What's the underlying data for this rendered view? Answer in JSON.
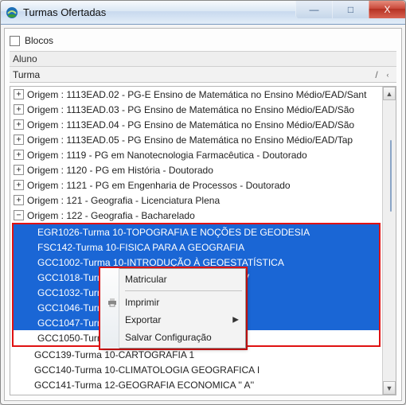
{
  "window": {
    "title": "Turmas Ofertadas",
    "minimize_glyph": "—",
    "maximize_glyph": "□",
    "close_glyph": "X"
  },
  "blocos": {
    "label": "Blocos"
  },
  "aluno_label": "Aluno",
  "turma_col": {
    "label": "Turma",
    "mark": "/"
  },
  "rows": {
    "r0": "Origem : 1113EAD.02 - PG-E Ensino de Matemática no Ensino Médio/EAD/Sant",
    "r1": "Origem : 1113EAD.03 - PG Ensino de Matemática no Ensino Médio/EAD/São",
    "r2": "Origem : 1113EAD.04 - PG Ensino de Matemática no Ensino Médio/EAD/São",
    "r3": "Origem : 1113EAD.05 - PG Ensino de Matemática no Ensino Médio/EAD/Tap",
    "r4": "Origem : 1119 - PG em Nanotecnologia Farmacêutica - Doutorado",
    "r5": "Origem : 1120 - PG em História - Doutorado",
    "r6": "Origem : 1121 - PG em Engenharia de Processos - Doutorado",
    "r7": "Origem : 121 - Geografia - Licenciatura Plena",
    "r8": "Origem : 122 - Geografia - Bacharelado",
    "c0": "EGR1026-Turma 10-TOPOGRAFIA E NOÇÕES DE GEODESIA",
    "c1": "FSC142-Turma 10-FISICA PARA A GEOGRAFIA",
    "c2": "GCC1002-Turma 10-INTRODUÇÃO À GEOESTATÍSTICA",
    "c3": "GCC1018-Turma-                                          MO, AÇÕES PARA O DESENV",
    "c4": "GCC1032-Turm                                            E PERÍCIA AMBIENTAL",
    "c5": "GCC1046-Turm                                            ICULTURA",
    "c6": "GCC1047-Turm                                            DO REAL AO VIRTUAL",
    "c7": "GCC1050-Turm                                            BRASILEIRA",
    "c8": "GCC139-Turma 10-CARTOGRAFIA 1",
    "c9": "GCC140-Turma 10-CLIMATOLOGIA GEOGRAFICA I",
    "c10": "GCC141-Turma 12-GEOGRAFIA ECONOMICA '' A''"
  },
  "expanders": {
    "plus": "+",
    "minus": "−"
  },
  "context_menu": {
    "matricular": "Matricular",
    "imprimir": "Imprimir",
    "exportar": "Exportar",
    "salvar": "Salvar Configuração"
  },
  "scroll": {
    "up": "▲",
    "down": "▼"
  },
  "arrow_right": "▶"
}
